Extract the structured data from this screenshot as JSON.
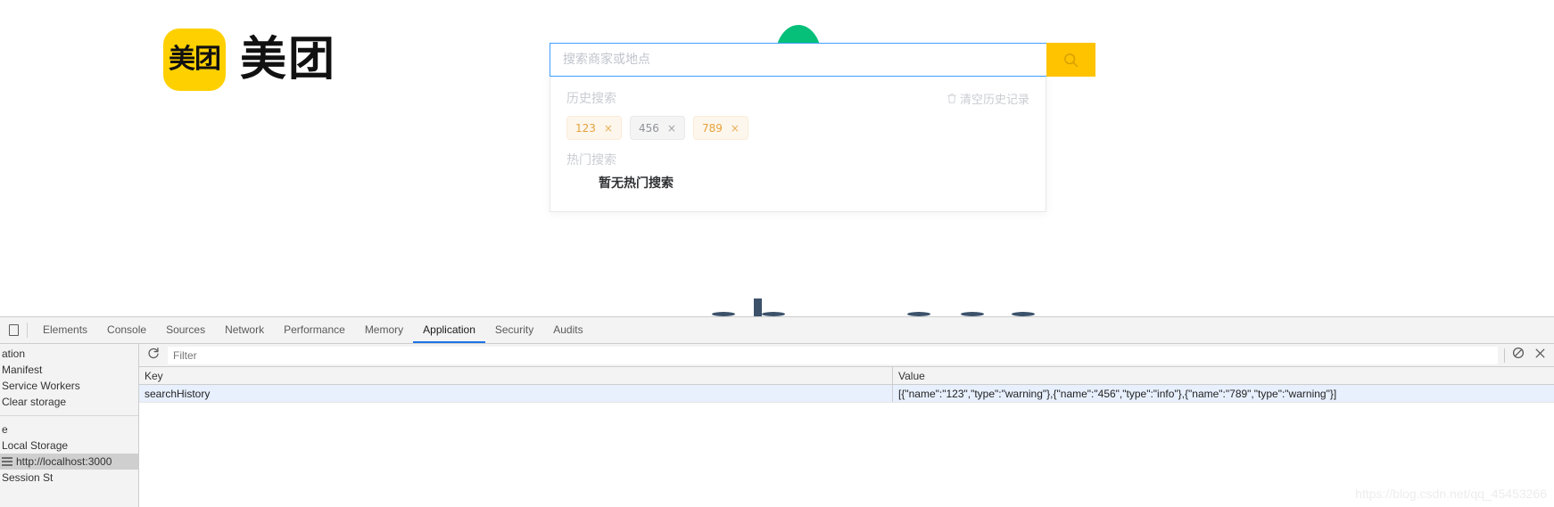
{
  "brand": {
    "mark_text": "美团",
    "word_text": "美团"
  },
  "search": {
    "placeholder": "搜索商家或地点",
    "value": "",
    "button_icon": "search-icon"
  },
  "panel": {
    "history_title": "历史搜索",
    "clear_label": "清空历史记录",
    "clear_icon": "trash-icon",
    "history_tags": [
      {
        "name": "123",
        "type": "warning",
        "close": "×"
      },
      {
        "name": "456",
        "type": "info",
        "close": "×"
      },
      {
        "name": "789",
        "type": "warning",
        "close": "×"
      }
    ],
    "hot_title": "热门搜索",
    "hot_empty": "暂无热门搜索"
  },
  "devtools": {
    "drawer_icon": "panel-toggle-icon",
    "tabs": [
      {
        "label": "Elements",
        "active": false
      },
      {
        "label": "Console",
        "active": false
      },
      {
        "label": "Sources",
        "active": false
      },
      {
        "label": "Network",
        "active": false
      },
      {
        "label": "Performance",
        "active": false
      },
      {
        "label": "Memory",
        "active": false
      },
      {
        "label": "Application",
        "active": true
      },
      {
        "label": "Security",
        "active": false
      },
      {
        "label": "Audits",
        "active": false
      }
    ],
    "sidebar": {
      "group1_label": "ation",
      "group1_items": [
        "Manifest",
        "Service Workers",
        "Clear storage"
      ],
      "group2_label": "e",
      "group2_items": [
        "Local Storage"
      ],
      "selected_origin": "http://localhost:3000",
      "origin_icon": "storage-icon",
      "partial_item": "Session St"
    },
    "toolbar": {
      "refresh_icon": "refresh-icon",
      "filter_placeholder": "Filter",
      "filter_value": "",
      "clear_icon": "no-entry-icon",
      "close_icon": "close-icon"
    },
    "table": {
      "columns": [
        "Key",
        "Value"
      ],
      "rows": [
        {
          "key": "searchHistory",
          "value": "[{\"name\":\"123\",\"type\":\"warning\"},{\"name\":\"456\",\"type\":\"info\"},{\"name\":\"789\",\"type\":\"warning\"}]"
        }
      ]
    }
  },
  "watermark": "https://blog.csdn.net/qq_45453266",
  "colors": {
    "brand_yellow": "#ffd000",
    "button_yellow": "#ffc300",
    "focus_blue": "#409eff",
    "dome_green": "#06bf79",
    "tag_warning_bg": "#fdf6ec",
    "tag_warning_fg": "#e6a23c",
    "tag_info_bg": "#f4f4f5",
    "tag_info_fg": "#909399",
    "devtools_accent": "#1a73e8"
  }
}
